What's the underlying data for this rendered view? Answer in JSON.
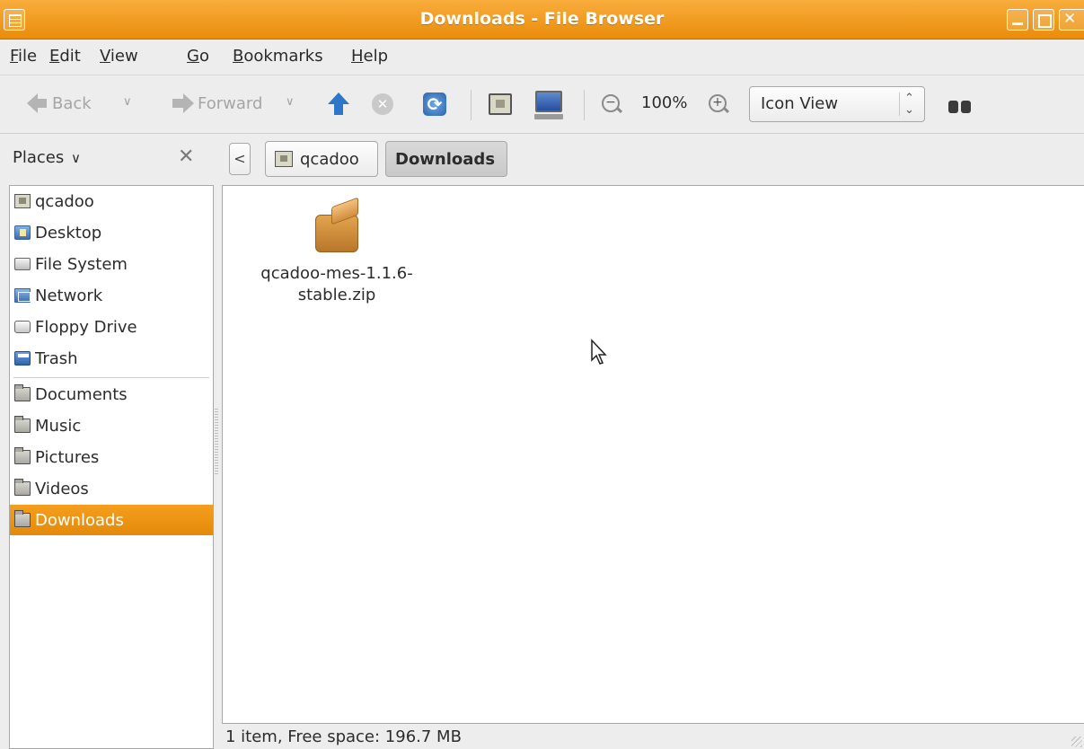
{
  "window": {
    "title": "Downloads - File Browser",
    "accent_color": "#F0960F"
  },
  "menubar": {
    "items": [
      {
        "label": "File",
        "mnemonic": "F",
        "rest": "ile"
      },
      {
        "label": "Edit",
        "mnemonic": "E",
        "rest": "dit"
      },
      {
        "label": "View",
        "mnemonic": "V",
        "rest": "iew"
      },
      {
        "label": "Go",
        "mnemonic": "G",
        "rest": "o"
      },
      {
        "label": "Bookmarks",
        "mnemonic": "B",
        "rest": "ookmarks"
      },
      {
        "label": "Help",
        "mnemonic": "H",
        "rest": "elp"
      }
    ]
  },
  "toolbar": {
    "back_label": "Back",
    "forward_label": "Forward",
    "zoom_level": "100%",
    "view_mode": "Icon View",
    "icons": [
      "back-arrow-icon",
      "forward-arrow-icon",
      "up-arrow-icon",
      "stop-icon",
      "reload-icon",
      "home-icon",
      "computer-icon",
      "zoom-out-icon",
      "zoom-in-icon",
      "search-binoculars-icon"
    ]
  },
  "places": {
    "header_label": "Places",
    "items_primary": [
      {
        "label": "qcadoo",
        "icon": "home-folder-icon"
      },
      {
        "label": "Desktop",
        "icon": "desktop-icon"
      },
      {
        "label": "File System",
        "icon": "drive-icon"
      },
      {
        "label": "Network",
        "icon": "network-icon"
      },
      {
        "label": "Floppy Drive",
        "icon": "floppy-icon"
      },
      {
        "label": "Trash",
        "icon": "trash-icon"
      }
    ],
    "items_bookmarks": [
      {
        "label": "Documents",
        "icon": "folder-icon"
      },
      {
        "label": "Music",
        "icon": "folder-icon"
      },
      {
        "label": "Pictures",
        "icon": "folder-icon"
      },
      {
        "label": "Videos",
        "icon": "folder-icon"
      },
      {
        "label": "Downloads",
        "icon": "folder-icon",
        "selected": true
      }
    ]
  },
  "pathbar": {
    "segments": [
      {
        "label": "qcadoo",
        "icon": "home-folder-icon",
        "active": false
      },
      {
        "label": "Downloads",
        "active": true
      }
    ]
  },
  "content": {
    "files": [
      {
        "name_line1": "qcadoo-mes-1.1.6-",
        "name_line2": "stable.zip",
        "icon": "package-icon"
      }
    ]
  },
  "statusbar": {
    "text": "1 item, Free space: 196.7 MB"
  }
}
